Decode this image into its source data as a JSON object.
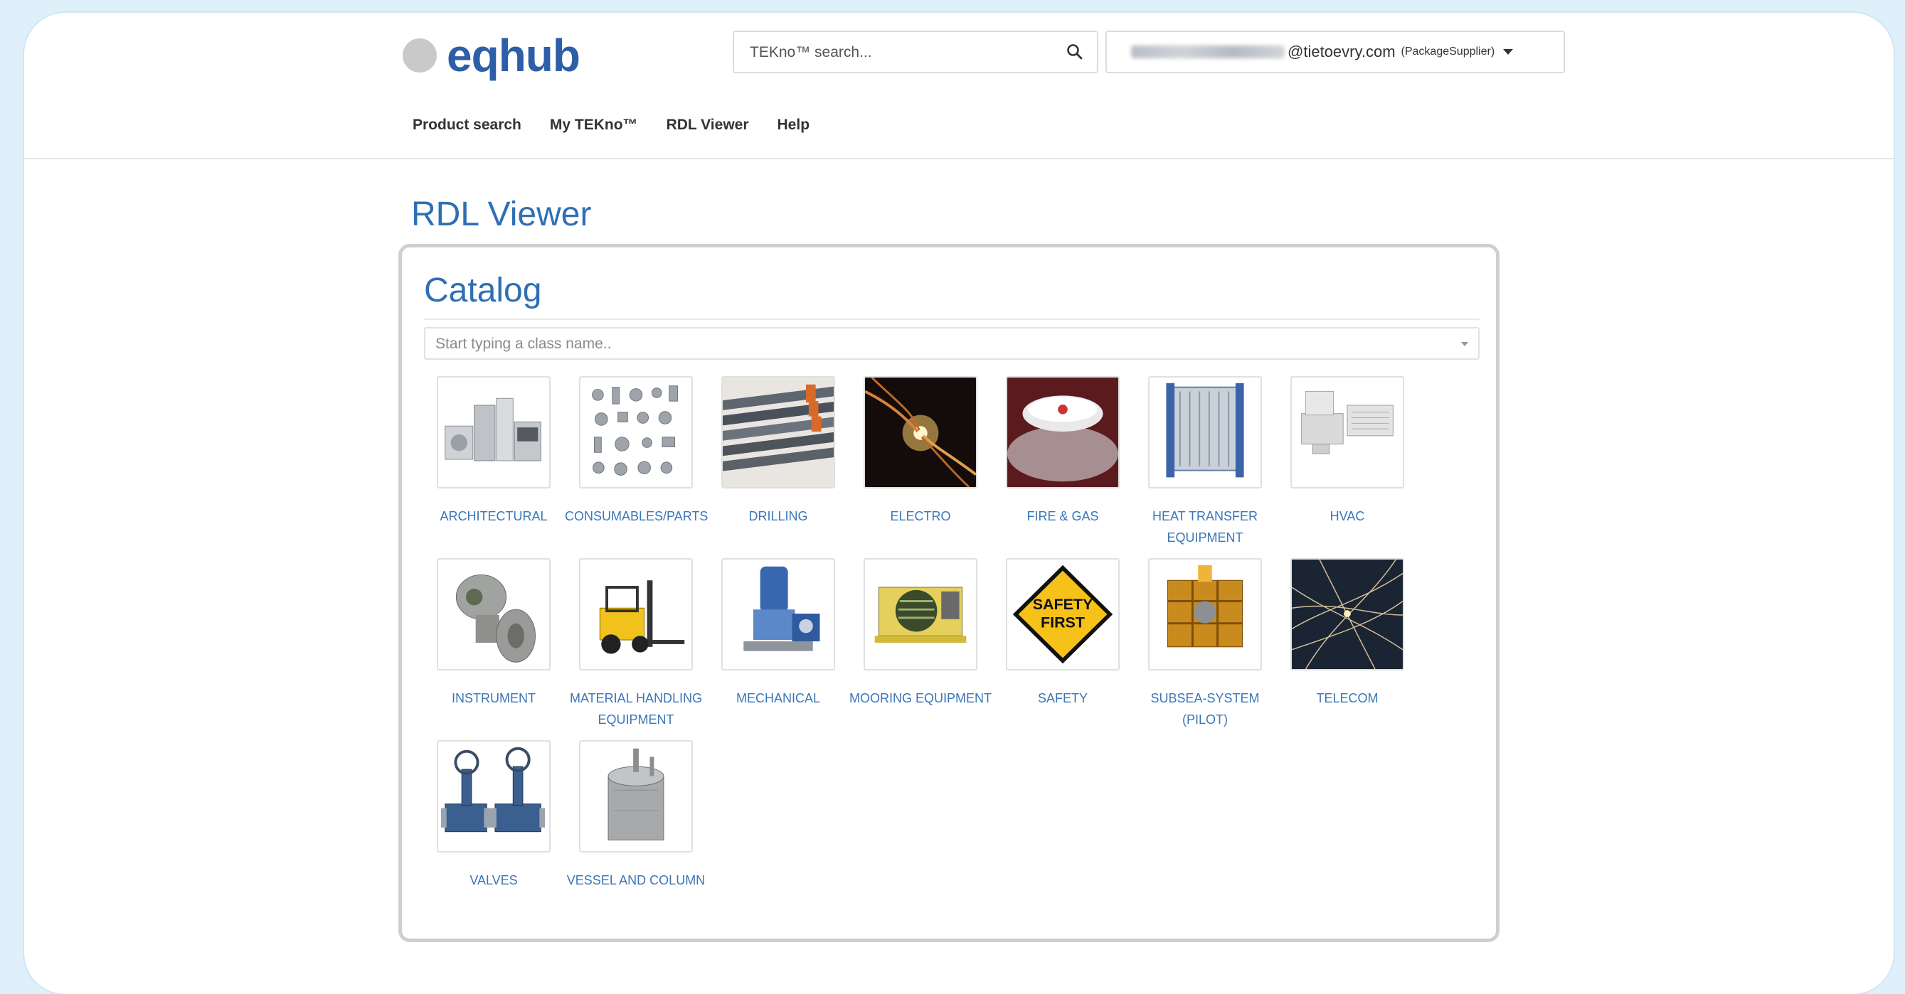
{
  "header": {
    "logo_text": "eqhub",
    "search_placeholder": "TEKno™ search...",
    "user_email_visible": "@tietoevry.com",
    "user_role": "(PackageSupplier)"
  },
  "nav": {
    "items": [
      "Product search",
      "My TEKno™",
      "RDL Viewer",
      "Help"
    ]
  },
  "page": {
    "title": "RDL Viewer",
    "catalog_title": "Catalog",
    "class_placeholder": "Start typing a class name.."
  },
  "catalog": {
    "items": [
      {
        "label": "ARCHITECTURAL",
        "icon": "appliances-image"
      },
      {
        "label": "CONSUMABLES/PARTS",
        "icon": "fittings-image"
      },
      {
        "label": "DRILLING",
        "icon": "drill-pipes-image"
      },
      {
        "label": "ELECTRO",
        "icon": "cables-image"
      },
      {
        "label": "FIRE & GAS",
        "icon": "smoke-detector-image"
      },
      {
        "label": "HEAT TRANSFER EQUIPMENT",
        "icon": "plate-heat-exchanger-image"
      },
      {
        "label": "HVAC",
        "icon": "hvac-unit-image"
      },
      {
        "label": "INSTRUMENT",
        "icon": "transmitter-image"
      },
      {
        "label": "MATERIAL HANDLING EQUIPMENT",
        "icon": "forklift-image"
      },
      {
        "label": "MECHANICAL",
        "icon": "pump-image"
      },
      {
        "label": "MOORING EQUIPMENT",
        "icon": "winch-image"
      },
      {
        "label": "SAFETY",
        "icon": "safety-first-sign-image"
      },
      {
        "label": "SUBSEA-SYSTEM (PILOT)",
        "icon": "subsea-module-image"
      },
      {
        "label": "TELECOM",
        "icon": "network-lines-image"
      },
      {
        "label": "VALVES",
        "icon": "valves-image"
      },
      {
        "label": "VESSEL AND COLUMN",
        "icon": "pressure-vessel-image"
      }
    ],
    "safety_sign_text": [
      "SAFETY",
      "FIRST"
    ]
  }
}
